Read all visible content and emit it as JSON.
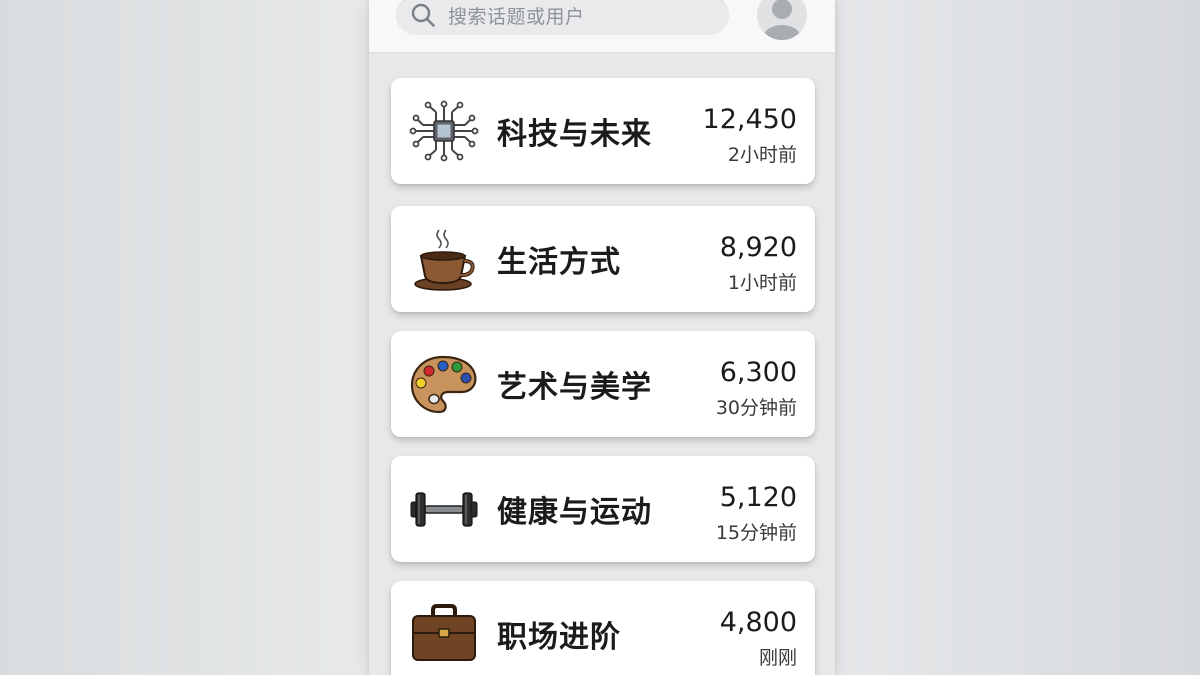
{
  "header": {
    "search_placeholder": "搜索话题或用户",
    "search_icon": "search-icon",
    "avatar_icon": "user-avatar-icon"
  },
  "topics": [
    {
      "title": "科技与未来",
      "count": "12,450",
      "time": "2小时前",
      "icon": "circuit-chip-icon"
    },
    {
      "title": "生活方式",
      "count": "8,920",
      "time": "1小时前",
      "icon": "coffee-cup-icon"
    },
    {
      "title": "艺术与美学",
      "count": "6,300",
      "time": "30分钟前",
      "icon": "paint-palette-icon"
    },
    {
      "title": "健康与运动",
      "count": "5,120",
      "time": "15分钟前",
      "icon": "dumbbell-icon"
    },
    {
      "title": "职场进阶",
      "count": "4,800",
      "time": "刚刚",
      "icon": "briefcase-icon"
    }
  ]
}
